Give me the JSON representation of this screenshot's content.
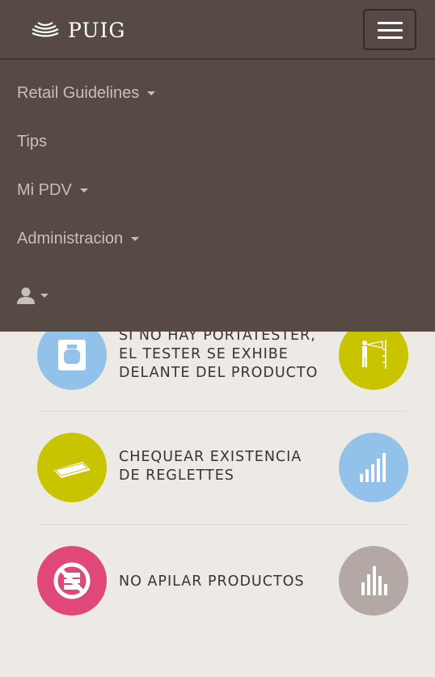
{
  "header": {
    "logo_text": "PUIG"
  },
  "menu": {
    "items": [
      {
        "label": "Retail Guidelines",
        "has_caret": true
      },
      {
        "label": "Tips",
        "has_caret": false
      },
      {
        "label": "Mi PDV",
        "has_caret": true
      },
      {
        "label": "Administracion",
        "has_caret": true
      }
    ]
  },
  "rows": [
    {
      "text": "SI NO HAY PORTATESTER,\nEL TESTER SE EXHIBE\nDELANTE DEL PRODUCTO",
      "left_icon": "perfume-bottle-icon",
      "right_icon": "person-spray-height-icon"
    },
    {
      "text": "CHEQUEAR EXISTENCIA\nDE REGLETTES",
      "left_icon": "reglette-icon",
      "right_icon": "bar-chart-icon"
    },
    {
      "text": "NO APILAR PRODUCTOS",
      "left_icon": "no-stacking-icon",
      "right_icon": "bar-chart-icon"
    }
  ],
  "colors": {
    "nav_bg": "#574a45",
    "page_bg": "#ede9e5",
    "blue": "#92c1e9",
    "olive": "#c9c400",
    "pink": "#e0487a",
    "taupe": "#b3a8a3"
  }
}
